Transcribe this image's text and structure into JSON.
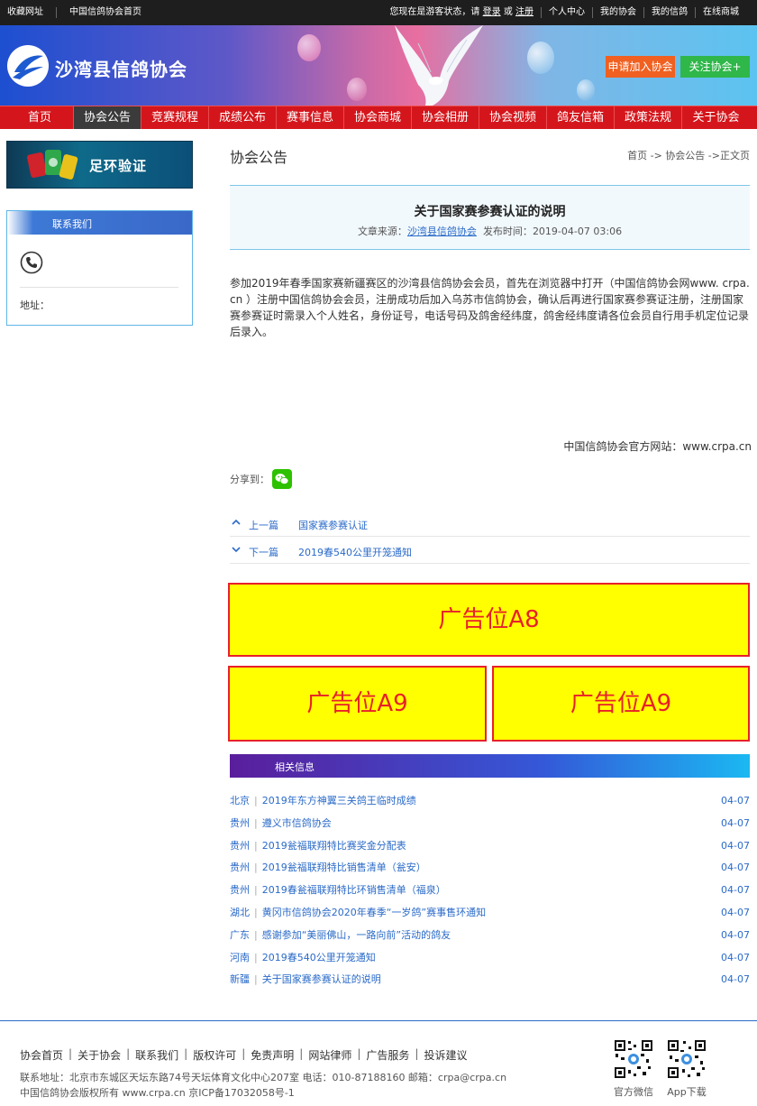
{
  "topbar": {
    "fav": "收藏网址",
    "home": "中国信鸽协会首页",
    "status_prefix": "您现在是游客状态，请",
    "login": "登录",
    "or": "或",
    "register": "注册",
    "personal": "个人中心",
    "my_assoc": "我的协会",
    "my_pigeon": "我的信鸽",
    "mall": "在线商城"
  },
  "header": {
    "site_name": "沙湾县信鸽协会",
    "join_label": "申请加入协会",
    "follow_label": "关注协会+"
  },
  "nav": [
    "首页",
    "协会公告",
    "竞赛规程",
    "成绩公布",
    "赛事信息",
    "协会商城",
    "协会相册",
    "协会视频",
    "鸽友信箱",
    "政策法规",
    "关于协会"
  ],
  "nav_active": 1,
  "sidebar": {
    "banner_text": "足环验证",
    "contact_title": "联系我们",
    "address_label": "地址："
  },
  "main": {
    "section_title": "协会公告",
    "crumb": "首页 -> 协会公告 ->正文页",
    "article_title": "关于国家赛参赛认证的说明",
    "source_label": "文章来源：",
    "source": "沙湾县信鸽协会",
    "time_label": "发布时间：",
    "time": "2019-04-07 03:06",
    "body": "参加2019年春季国家赛新疆赛区的沙湾县信鸽协会会员，首先在浏览器中打开（中国信鸽协会网www. crpa.cn ）注册中国信鸽协会会员，注册成功后加入乌苏市信鸽协会，确认后再进行国家赛参赛证注册，注册国家赛参赛证时需录入个人姓名，身份证号，电话号码及鸽舍经纬度，鸽舍经纬度请各位会员自行用手机定位记录后录入。",
    "official": "中国信鸽协会官方网站：www.crpa.cn",
    "share_label": "分享到：",
    "prev_label": "上一篇",
    "prev_title": "国家赛参赛认证",
    "next_label": "下一篇",
    "next_title": "2019春540公里开笼通知",
    "ad_a8": "广告位A8",
    "ad_a9_left": "广告位A9",
    "ad_a9_right": "广告位A9",
    "related_title": "相关信息"
  },
  "related": [
    {
      "region": "北京",
      "title": "2019年东方神翼三关鸽王临时成绩",
      "date": "04-07"
    },
    {
      "region": "贵州",
      "title": "遵义市信鸽协会",
      "date": "04-07"
    },
    {
      "region": "贵州",
      "title": "2019瓮福联翔特比赛奖金分配表",
      "date": "04-07"
    },
    {
      "region": "贵州",
      "title": "2019瓮福联翔特比销售清单（瓮安）",
      "date": "04-07"
    },
    {
      "region": "贵州",
      "title": "2019春瓮福联翔特比环销售清单（福泉）",
      "date": "04-07"
    },
    {
      "region": "湖北",
      "title": "黄冈市信鸽协会2020年春季“一岁鸽”赛事售环通知",
      "date": "04-07"
    },
    {
      "region": "广东",
      "title": "感谢参加“美丽佛山，一路向前”活动的鸽友",
      "date": "04-07"
    },
    {
      "region": "河南",
      "title": "2019春540公里开笼通知",
      "date": "04-07"
    },
    {
      "region": "新疆",
      "title": "关于国家赛参赛认证的说明",
      "date": "04-07"
    }
  ],
  "footer": {
    "links": [
      "协会首页",
      "关于协会",
      "联系我们",
      "版权许可",
      "免责声明",
      "网站律师",
      "广告服务",
      "投诉建议"
    ],
    "address": "联系地址：北京市东城区天坛东路74号天坛体育文化中心207室 电话：010-87188160 邮箱：crpa@crpa.cn",
    "copyright": "中国信鸽协会版权所有 www.crpa.cn 京ICP备17032058号-1",
    "qr_wechat": "官方微信",
    "qr_app": "App下载"
  },
  "colors": {
    "nav_red": "#d4161c",
    "nav_active": "#3b3b3b",
    "link_blue": "#2a6ac8",
    "ad_yellow": "#ffff00",
    "ad_red": "#e8202a",
    "join_orange": "#f06020",
    "follow_green": "#2fb74a"
  }
}
